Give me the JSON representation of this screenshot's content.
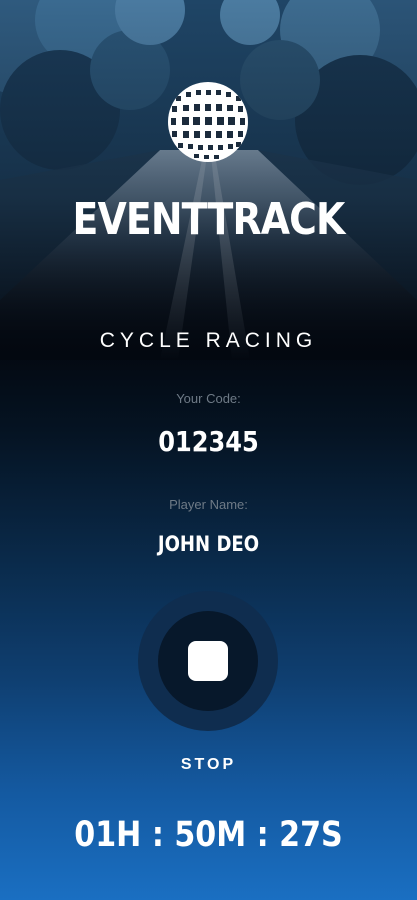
{
  "app": {
    "title": "EVENTTRACK",
    "logo_icon": "globe-icon"
  },
  "event": {
    "name": "CYCLE RACING"
  },
  "player": {
    "code_label": "Your Code:",
    "code": "012345",
    "name_label": "Player Name:",
    "name": "JOHN DEO"
  },
  "control": {
    "icon": "stop-icon",
    "label": "STOP"
  },
  "timer": {
    "display": "01H : 50M : 27S"
  },
  "colors": {
    "background_top": "#234a6e",
    "background_mid": "#030810",
    "background_bottom": "#1a6fc2",
    "stop_ring": "#0f2d4f",
    "stop_core": "#07182b",
    "label_gray": "#6e7a86"
  }
}
